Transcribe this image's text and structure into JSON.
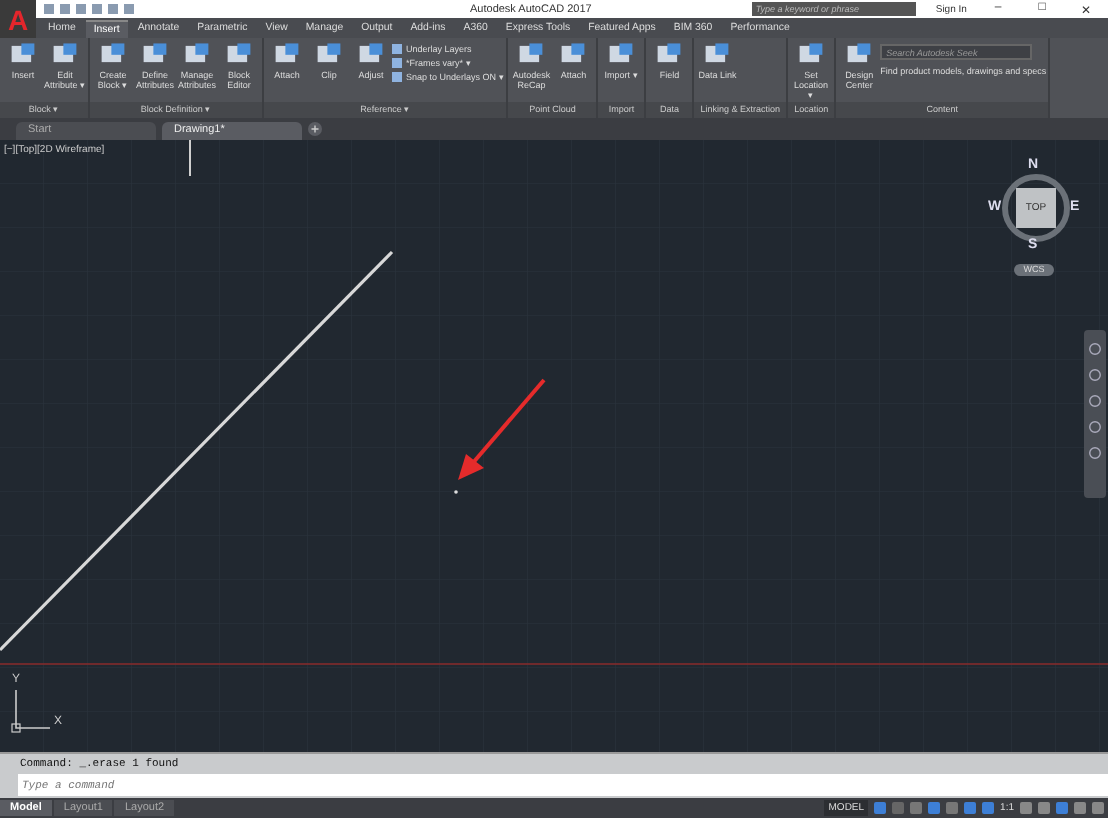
{
  "window": {
    "logo": "A",
    "title": "Autodesk AutoCAD 2017",
    "search": {
      "placeholder": "Type a keyword or phrase"
    },
    "sign_in": "Sign In",
    "controls": [
      "–",
      "□",
      "✕"
    ]
  },
  "ribbon_tabs": [
    {
      "label": "Home",
      "selected": false
    },
    {
      "label": "Insert",
      "selected": true
    },
    {
      "label": "Annotate",
      "selected": false
    },
    {
      "label": "Parametric",
      "selected": false
    },
    {
      "label": "View",
      "selected": false
    },
    {
      "label": "Manage",
      "selected": false
    },
    {
      "label": "Output",
      "selected": false
    },
    {
      "label": "Add-ins",
      "selected": false
    },
    {
      "label": "A360",
      "selected": false
    },
    {
      "label": "Express Tools",
      "selected": false
    },
    {
      "label": "Featured Apps",
      "selected": false
    },
    {
      "label": "BIM 360",
      "selected": false
    },
    {
      "label": "Performance",
      "selected": false
    }
  ],
  "ribbon_groups": [
    {
      "label": "Block ▾",
      "items": [
        {
          "kind": "large",
          "label": "Insert"
        },
        {
          "kind": "large",
          "label": "Edit Attribute ▾"
        }
      ]
    },
    {
      "label": "Block Definition ▾",
      "items": [
        {
          "kind": "large",
          "label": "Create Block ▾"
        },
        {
          "kind": "large",
          "label": "Define Attributes"
        },
        {
          "kind": "large",
          "label": "Manage Attributes"
        },
        {
          "kind": "large",
          "label": "Block Editor"
        }
      ]
    },
    {
      "label": "Reference ▾",
      "items": [
        {
          "kind": "large",
          "label": "Attach"
        },
        {
          "kind": "large",
          "label": "Clip"
        },
        {
          "kind": "large",
          "label": "Adjust"
        },
        {
          "kind": "small",
          "label": "Underlay Layers"
        },
        {
          "kind": "small",
          "label": "*Frames vary* ▾"
        },
        {
          "kind": "small",
          "label": "Snap to Underlays ON ▾"
        }
      ]
    },
    {
      "label": "Point Cloud",
      "items": [
        {
          "kind": "large",
          "label": "Autodesk ReCap"
        },
        {
          "kind": "large",
          "label": "Attach"
        }
      ]
    },
    {
      "label": "Import",
      "items": [
        {
          "kind": "large",
          "label": "Import ▾"
        }
      ]
    },
    {
      "label": "Data",
      "items": [
        {
          "kind": "large",
          "label": "Field"
        }
      ]
    },
    {
      "label": "Linking & Extraction",
      "items": [
        {
          "kind": "large",
          "label": "Data Link"
        }
      ]
    },
    {
      "label": "Location",
      "items": [
        {
          "kind": "large",
          "label": "Set Location ▾"
        }
      ]
    },
    {
      "label": "Content",
      "items": [
        {
          "kind": "large",
          "label": "Design Center"
        },
        {
          "kind": "search",
          "placeholder": "Search Autodesk Seek",
          "label": "Find product models, drawings and specs"
        }
      ]
    }
  ],
  "doc_tabs": [
    {
      "label": "Start",
      "selected": false
    },
    {
      "label": "Drawing1*",
      "selected": true
    }
  ],
  "viewport": {
    "label": "[−][Top][2D Wireframe]",
    "viewcube": {
      "n": "N",
      "w": "W",
      "e": "E",
      "s": "S",
      "face": "TOP",
      "ucs": "WCS"
    },
    "ucs_icon": {
      "x": "X",
      "y": "Y"
    }
  },
  "command_line": {
    "history": "Command: _.erase 1 found",
    "placeholder": "Type a command"
  },
  "layout_tabs": [
    {
      "label": "Model",
      "selected": true
    },
    {
      "label": "Layout1",
      "selected": false
    },
    {
      "label": "Layout2",
      "selected": false
    }
  ],
  "status_bar": {
    "space": "MODEL",
    "scale": "1:1"
  }
}
